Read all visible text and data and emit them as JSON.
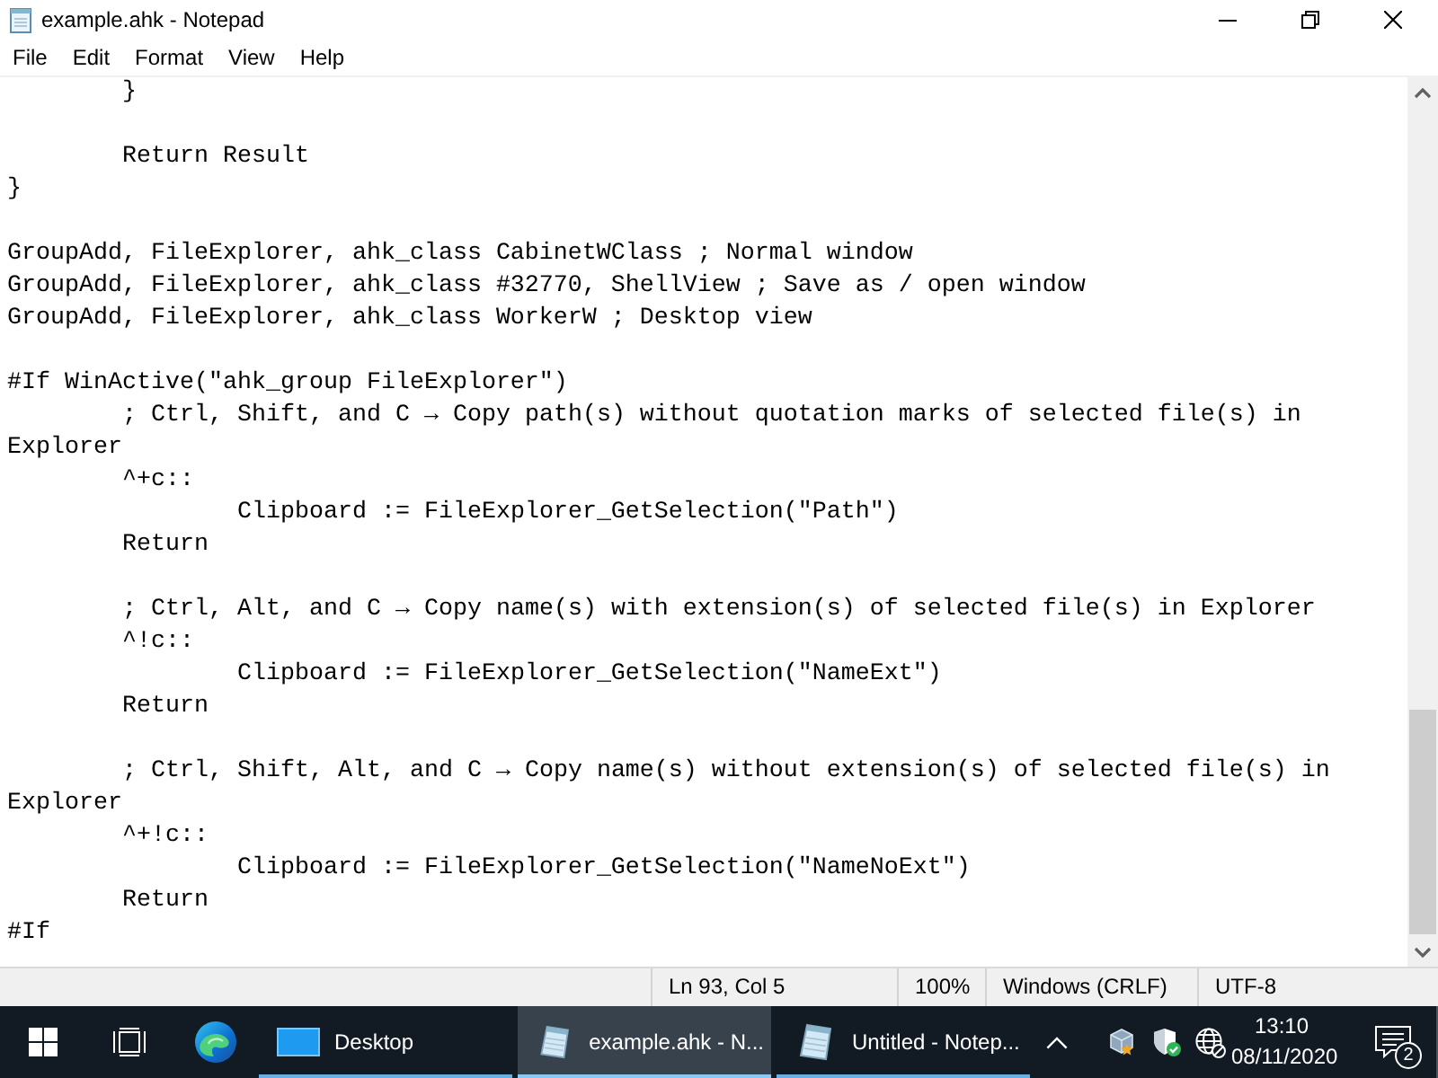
{
  "window": {
    "title": "example.ahk - Notepad"
  },
  "menu": [
    "File",
    "Edit",
    "Format",
    "View",
    "Help"
  ],
  "editor": {
    "lines": [
      {
        "kind": "code",
        "text": "\t}"
      },
      {
        "kind": "blank"
      },
      {
        "kind": "code",
        "text": "\tReturn Result"
      },
      {
        "kind": "code",
        "text": "}"
      },
      {
        "kind": "blank"
      },
      {
        "kind": "code",
        "text": "GroupAdd, FileExplorer, ahk_class CabinetWClass ; Normal window"
      },
      {
        "kind": "code",
        "text": "GroupAdd, FileExplorer, ahk_class #32770, ShellView ; Save as / open window"
      },
      {
        "kind": "code",
        "text": "GroupAdd, FileExplorer, ahk_class WorkerW ; Desktop view"
      },
      {
        "kind": "blank"
      },
      {
        "kind": "code",
        "text": "#If WinActive(\"ahk_group FileExplorer\")"
      },
      {
        "kind": "code",
        "text": "\t; Ctrl, Shift, and C → Copy path(s) without quotation marks of selected file(s) in Explorer"
      },
      {
        "kind": "code",
        "text": "\t^+c::"
      },
      {
        "kind": "code",
        "text": "\t\tClipboard := FileExplorer_GetSelection(\"Path\")"
      },
      {
        "kind": "code",
        "text": "\tReturn"
      },
      {
        "kind": "blank"
      },
      {
        "kind": "code",
        "text": "\t; Ctrl, Alt, and C → Copy name(s) with extension(s) of selected file(s) in Explorer"
      },
      {
        "kind": "code",
        "text": "\t^!c::"
      },
      {
        "kind": "code",
        "text": "\t\tClipboard := FileExplorer_GetSelection(\"NameExt\")"
      },
      {
        "kind": "code",
        "text": "\tReturn"
      },
      {
        "kind": "blank"
      },
      {
        "kind": "code",
        "text": "\t; Ctrl, Shift, Alt, and C → Copy name(s) without extension(s) of selected file(s) in Explorer"
      },
      {
        "kind": "code",
        "text": "\t^+!c::"
      },
      {
        "kind": "code",
        "text": "\t\tClipboard := FileExplorer_GetSelection(\"NameNoExt\")"
      },
      {
        "kind": "code",
        "text": "\tReturn"
      },
      {
        "kind": "code",
        "text": "#If"
      }
    ]
  },
  "status_bar": {
    "position": "Ln 93, Col 5",
    "zoom": "100%",
    "line_ending": "Windows (CRLF)",
    "encoding": "UTF-8"
  },
  "taskbar": {
    "windows": [
      {
        "kind": "desktop",
        "label": "Desktop",
        "selected": false
      },
      {
        "kind": "notepad",
        "label": "example.ahk - N...",
        "selected": true
      },
      {
        "kind": "notepad",
        "label": "Untitled - Notep...",
        "selected": false
      }
    ],
    "clock": {
      "time": "13:10",
      "date": "08/11/2020"
    },
    "notifications": "2"
  }
}
